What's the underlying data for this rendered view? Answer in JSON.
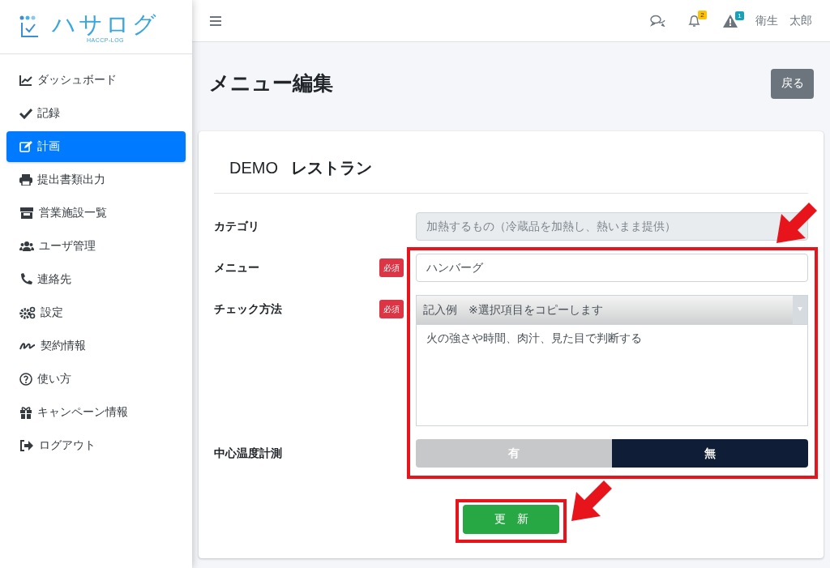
{
  "sidebar": {
    "logo": {
      "title": "ハサログ",
      "subtitle": "HACCP-LOG"
    },
    "items": [
      {
        "label": "ダッシュボード",
        "selected": false
      },
      {
        "label": "記録",
        "selected": false
      },
      {
        "label": "計画",
        "selected": true
      },
      {
        "label": "提出書類出力",
        "selected": false
      },
      {
        "label": "営業施設一覧",
        "selected": false
      },
      {
        "label": "ユーザ管理",
        "selected": false
      },
      {
        "label": "連絡先",
        "selected": false
      },
      {
        "label": "設定",
        "selected": false
      },
      {
        "label": "契約情報",
        "selected": false
      },
      {
        "label": "使い方",
        "selected": false
      },
      {
        "label": "キャンペーン情報",
        "selected": false
      },
      {
        "label": "ログアウト",
        "selected": false
      }
    ]
  },
  "header": {
    "notifications": [
      {
        "kind": "bell",
        "count": "2",
        "color": "#ffc107"
      },
      {
        "kind": "warning",
        "count": "1",
        "color": "#17a2b8"
      }
    ],
    "user": "衛生　太郎"
  },
  "page": {
    "title": "メニュー編集",
    "back_button": "戻る"
  },
  "card": {
    "store_prefix": "DEMO",
    "store_name": "レストラン",
    "fields": [
      {
        "kind": "text",
        "label": "カテゴリ",
        "value": "加熱するもの（冷蔵品を加熱し、熱いまま提供）",
        "disabled": true
      },
      {
        "kind": "text",
        "label": "メニュー",
        "badge": "必須",
        "value": "ハンバーグ",
        "disabled": false
      },
      {
        "kind": "select-text",
        "label": "チェック方法",
        "badge": "必須",
        "select": "記入例　※選択項目をコピーします",
        "value": "火の強さや時間、肉汁、見た目で判断する"
      },
      {
        "kind": "toggle",
        "label": "中心温度計測",
        "options": [
          {
            "label": "有",
            "selected": false
          },
          {
            "label": "無",
            "selected": true
          }
        ]
      }
    ],
    "submit": "更　新"
  }
}
